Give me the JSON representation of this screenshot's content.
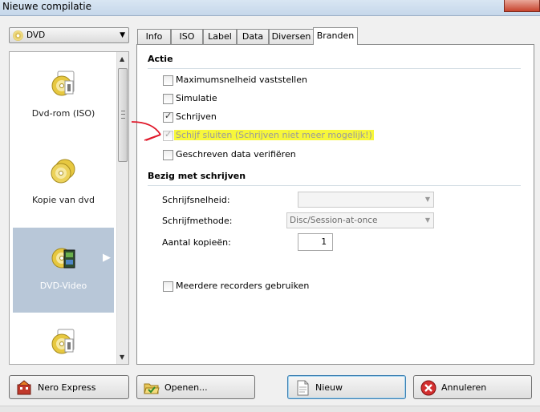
{
  "window": {
    "title": "Nieuwe compilatie"
  },
  "left": {
    "disc_type": "DVD",
    "items": [
      {
        "label": "Dvd-rom (ISO)",
        "icon": "dvd-rom-icon"
      },
      {
        "label": "Kopie van dvd",
        "icon": "copy-dvd-icon"
      },
      {
        "label": "DVD-Video",
        "icon": "dvd-video-icon",
        "selected": true
      },
      {
        "label": "",
        "icon": "dvd-rom-icon"
      }
    ]
  },
  "tabs": [
    {
      "label": "Info"
    },
    {
      "label": "ISO"
    },
    {
      "label": "Label"
    },
    {
      "label": "Data"
    },
    {
      "label": "Diversen"
    },
    {
      "label": "Branden",
      "active": true
    }
  ],
  "actie": {
    "heading": "Actie",
    "options": [
      {
        "label": "Maximumsnelheid vaststellen",
        "checked": false
      },
      {
        "label": "Simulatie",
        "checked": false
      },
      {
        "label": "Schrijven",
        "checked": true
      },
      {
        "label": "Schijf sluiten (Schrijven niet meer mogelijk!)",
        "checked": true,
        "disabled": true,
        "highlight_color": "#f7f73a"
      },
      {
        "label": "Geschreven data verifiëren",
        "checked": false
      }
    ]
  },
  "schrijven": {
    "heading": "Bezig met schrijven",
    "speed_label": "Schrijfsnelheid:",
    "speed_value": "",
    "method_label": "Schrijfmethode:",
    "method_value": "Disc/Session-at-once",
    "copies_label": "Aantal kopieën:",
    "copies_value": "1",
    "multi_recorder_label": "Meerdere recorders gebruiken",
    "multi_recorder_checked": false
  },
  "buttons": {
    "nero_express": "Nero Express",
    "openen": "Openen...",
    "nieuw": "Nieuw",
    "annuleren": "Annuleren"
  },
  "colors": {
    "annotation_arrow": "#e0182a",
    "selection": "#b8c7d8"
  }
}
